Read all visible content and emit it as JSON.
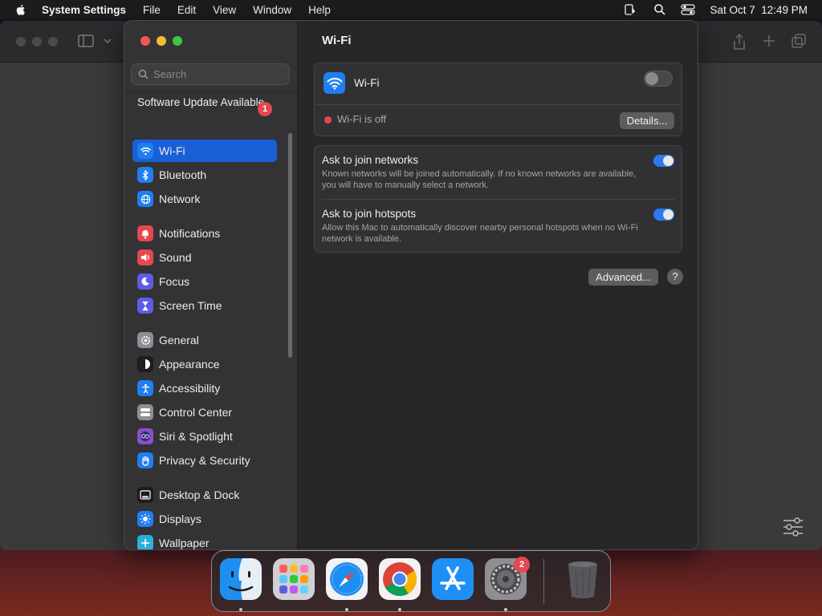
{
  "menubar": {
    "app_name": "System Settings",
    "menus": [
      "File",
      "Edit",
      "View",
      "Window",
      "Help"
    ],
    "datetime": "Sat Oct 7  12:49 PM"
  },
  "search": {
    "placeholder": "Search"
  },
  "sidebar": {
    "update_label": "Software Update Available",
    "update_badge": "1",
    "items": [
      {
        "label": "Wi-Fi",
        "icon": "wifi-icon",
        "color": "#1f7ef0",
        "active": true
      },
      {
        "label": "Bluetooth",
        "icon": "bluetooth-icon",
        "color": "#1f7ef0"
      },
      {
        "label": "Network",
        "icon": "globe-icon",
        "color": "#1f7ef0"
      },
      {
        "label": "Notifications",
        "icon": "bell-icon",
        "color": "#e5484d"
      },
      {
        "label": "Sound",
        "icon": "speaker-icon",
        "color": "#e5484d"
      },
      {
        "label": "Focus",
        "icon": "moon-icon",
        "color": "#5e5ce6"
      },
      {
        "label": "Screen Time",
        "icon": "hourglass-icon",
        "color": "#5e5ce6"
      },
      {
        "label": "General",
        "icon": "gear-icon",
        "color": "#8e8e93"
      },
      {
        "label": "Appearance",
        "icon": "appearance-icon",
        "color": "#1c1c1e"
      },
      {
        "label": "Accessibility",
        "icon": "accessibility-icon",
        "color": "#1f7ef0"
      },
      {
        "label": "Control Center",
        "icon": "control-center-icon",
        "color": "#8e8e93"
      },
      {
        "label": "Siri & Spotlight",
        "icon": "siri-icon",
        "color": "#8a4fd0"
      },
      {
        "label": "Privacy & Security",
        "icon": "hand-icon",
        "color": "#1f7ef0"
      },
      {
        "label": "Desktop & Dock",
        "icon": "dock-icon",
        "color": "#1c1c1e"
      },
      {
        "label": "Displays",
        "icon": "sun-icon",
        "color": "#1f7ef0"
      },
      {
        "label": "Wallpaper",
        "icon": "wallpaper-icon",
        "color": "#2ab0d8"
      }
    ]
  },
  "main": {
    "title": "Wi-Fi",
    "wifi_row_label": "Wi-Fi",
    "wifi_enabled": false,
    "status_text": "Wi-Fi is off",
    "status_color": "#e5484d",
    "details_button": "Details...",
    "ask_networks_title": "Ask to join networks",
    "ask_networks_desc": "Known networks will be joined automatically. If no known networks are available, you will have to manually select a network.",
    "ask_networks_enabled": true,
    "ask_hotspots_title": "Ask to join hotspots",
    "ask_hotspots_desc": "Allow this Mac to automatically discover nearby personal hotspots when no Wi-Fi network is available.",
    "ask_hotspots_enabled": true,
    "advanced_button": "Advanced...",
    "help_button": "?"
  },
  "dock": {
    "apps": [
      "finder-icon",
      "launchpad-icon",
      "safari-icon",
      "chrome-icon",
      "app-store-icon",
      "system-settings-icon",
      "trash-icon"
    ],
    "settings_badge": "2"
  },
  "colors": {
    "accent": "#1a5fd6",
    "toggle_on": "#2a7bf2"
  }
}
